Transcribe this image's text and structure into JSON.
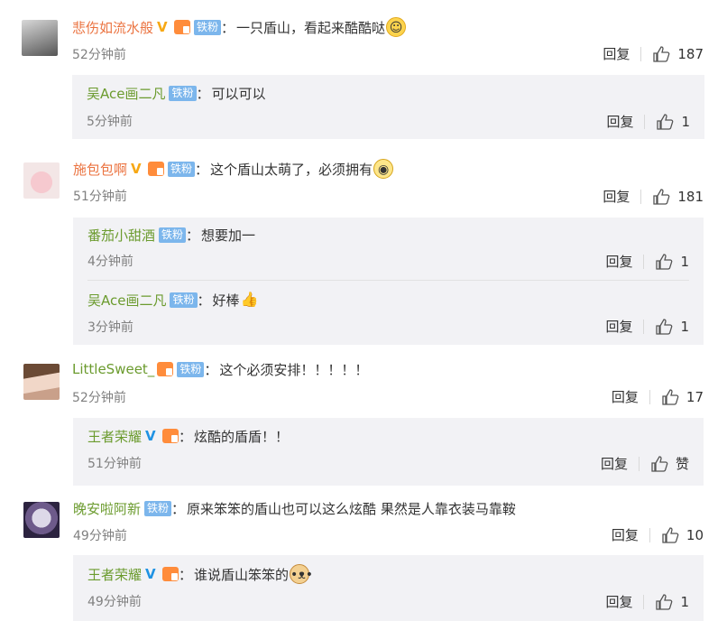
{
  "comments": [
    {
      "user": "悲伤如流水般",
      "tag": "铁粉",
      "text": "一只盾山，看起来酷酷哒",
      "time": "52分钟前",
      "reply": "回复",
      "likes": "187",
      "emoji": "smile-emoji",
      "replies": [
        {
          "user": "吴Ace画二凡",
          "tag": "铁粉",
          "text": "可以可以",
          "time": "5分钟前",
          "reply": "回复",
          "likes": "1"
        }
      ]
    },
    {
      "user": "施包包啊",
      "tag": "铁粉",
      "text": "这个盾山太萌了，必须拥有",
      "time": "51分钟前",
      "reply": "回复",
      "likes": "181",
      "emoji": "glasses-emoji",
      "replies": [
        {
          "user": "番茄小甜酒",
          "tag": "铁粉",
          "text": "想要加一",
          "time": "4分钟前",
          "reply": "回复",
          "likes": "1"
        },
        {
          "user": "吴Ace画二凡",
          "tag": "铁粉",
          "text": "好棒",
          "time": "3分钟前",
          "reply": "回复",
          "likes": "1"
        }
      ]
    },
    {
      "user": "LittleSweet_",
      "tag": "铁粉",
      "text": "这个必须安排！！！！！",
      "time": "52分钟前",
      "reply": "回复",
      "likes": "17",
      "replies": [
        {
          "user": "王者荣耀",
          "text": "炫酷的盾盾！！",
          "time": "51分钟前",
          "reply": "回复",
          "likes": "赞"
        }
      ]
    },
    {
      "user": "晚安啦阿新",
      "tag": "铁粉",
      "text": "原来笨笨的盾山也可以这么炫酷 果然是人靠衣装马靠鞍",
      "time": "49分钟前",
      "reply": "回复",
      "likes": "10",
      "replies": [
        {
          "user": "王者荣耀",
          "text": "谁说盾山笨笨的",
          "time": "49分钟前",
          "reply": "回复",
          "likes": "1"
        }
      ]
    }
  ],
  "colors": {
    "username": "#eb7340",
    "reply_username": "#6b9b2e",
    "tag_bg": "#7cb6ec",
    "sub_bg": "#f2f2f5",
    "time": "#808080"
  }
}
